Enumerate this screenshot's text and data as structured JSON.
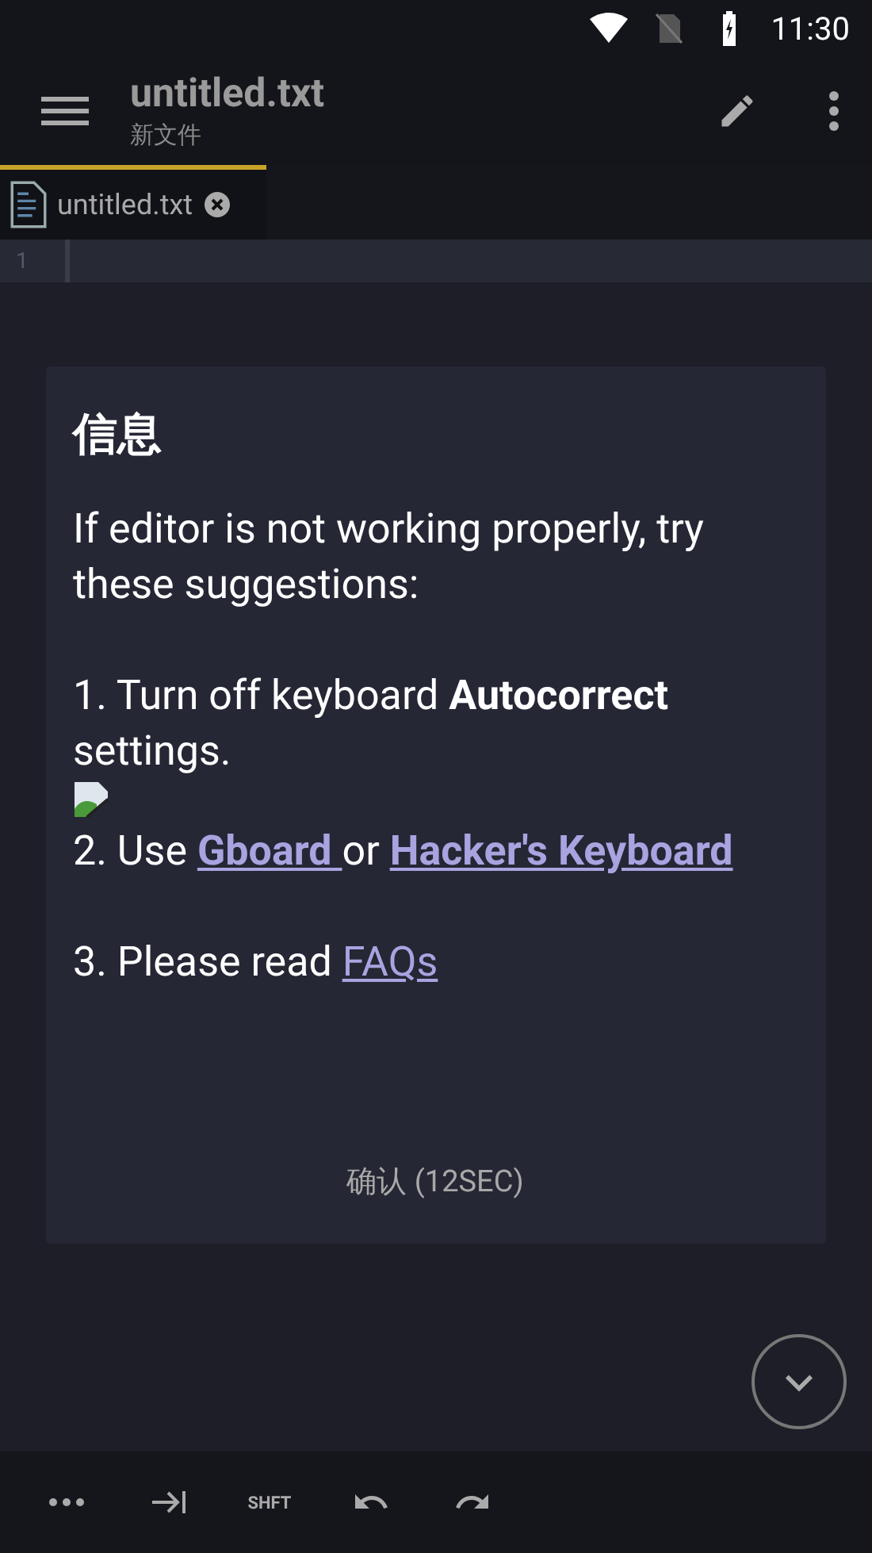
{
  "status_bar": {
    "time": "11:30"
  },
  "toolbar": {
    "title": "untitled.txt",
    "subtitle": "新文件"
  },
  "tabs": [
    {
      "label": "untitled.txt",
      "selected": true
    }
  ],
  "editor": {
    "line_numbers": [
      "1"
    ]
  },
  "dialog": {
    "title": "信息",
    "blocks": [
      {
        "kind": "text",
        "text": "If editor is not working properly, try these suggestions:"
      },
      {
        "kind": "text",
        "text": "1. Turn off keyboard **Autocorrect** settings."
      },
      {
        "kind": "image"
      },
      {
        "kind": "links",
        "segments": [
          {
            "text": "2. Use ",
            "link": false,
            "bold": false
          },
          {
            "text": "Gboard ",
            "link": true,
            "bold": true
          },
          {
            "text": "or ",
            "link": false,
            "bold": false
          },
          {
            "text": "Hacker's Keyboard ",
            "link": true,
            "bold": true
          }
        ]
      },
      {
        "kind": "links",
        "segments": [
          {
            "text": "3. Please read ",
            "link": false,
            "bold": false
          },
          {
            "text": "FAQs",
            "link": true,
            "bold": false
          }
        ]
      }
    ],
    "button": "确认 (12SEC)"
  },
  "bottom_keys": [
    {
      "kind": "more"
    },
    {
      "kind": "tab-end"
    },
    {
      "kind": "text",
      "label": "SHFT"
    },
    {
      "kind": "undo"
    },
    {
      "kind": "redo"
    }
  ]
}
